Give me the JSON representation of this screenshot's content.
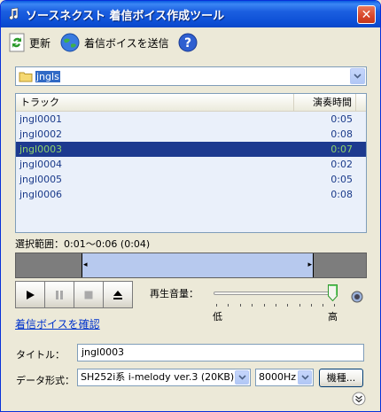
{
  "window": {
    "title": "ソースネクスト 着信ボイス作成ツール"
  },
  "toolbar": {
    "refresh_label": "更新",
    "send_label": "着信ボイスを送信"
  },
  "folder_select": {
    "value": "jngls"
  },
  "tracks": {
    "headers": {
      "track": "トラック",
      "duration": "演奏時間"
    },
    "rows": [
      {
        "name": "jngl0001",
        "duration": "0:05",
        "selected": false
      },
      {
        "name": "jngl0002",
        "duration": "0:08",
        "selected": false
      },
      {
        "name": "jngl0003",
        "duration": "0:07",
        "selected": true
      },
      {
        "name": "jngl0004",
        "duration": "0:02",
        "selected": false
      },
      {
        "name": "jngl0005",
        "duration": "0:05",
        "selected": false
      },
      {
        "name": "jngl0006",
        "duration": "0:08",
        "selected": false
      }
    ]
  },
  "selection": {
    "label": "選択範囲：0:01～0:06 (0:04)"
  },
  "volume": {
    "label": "再生音量：",
    "low": "低",
    "high": "高",
    "level": 1.0
  },
  "confirm_link": "着信ボイスを確認",
  "form": {
    "title_label": "タイトル：",
    "title_value": "jngl0003",
    "format_label": "データ形式：",
    "format_value": "SH252i系 i-melody ver.3 (20KB)",
    "rate_value": "8000Hz",
    "model_button": "機種..."
  },
  "colors": {
    "titlebar": "#0a5be0",
    "selected_row": "#1d3a8f",
    "selected_text": "#8fd16a"
  }
}
